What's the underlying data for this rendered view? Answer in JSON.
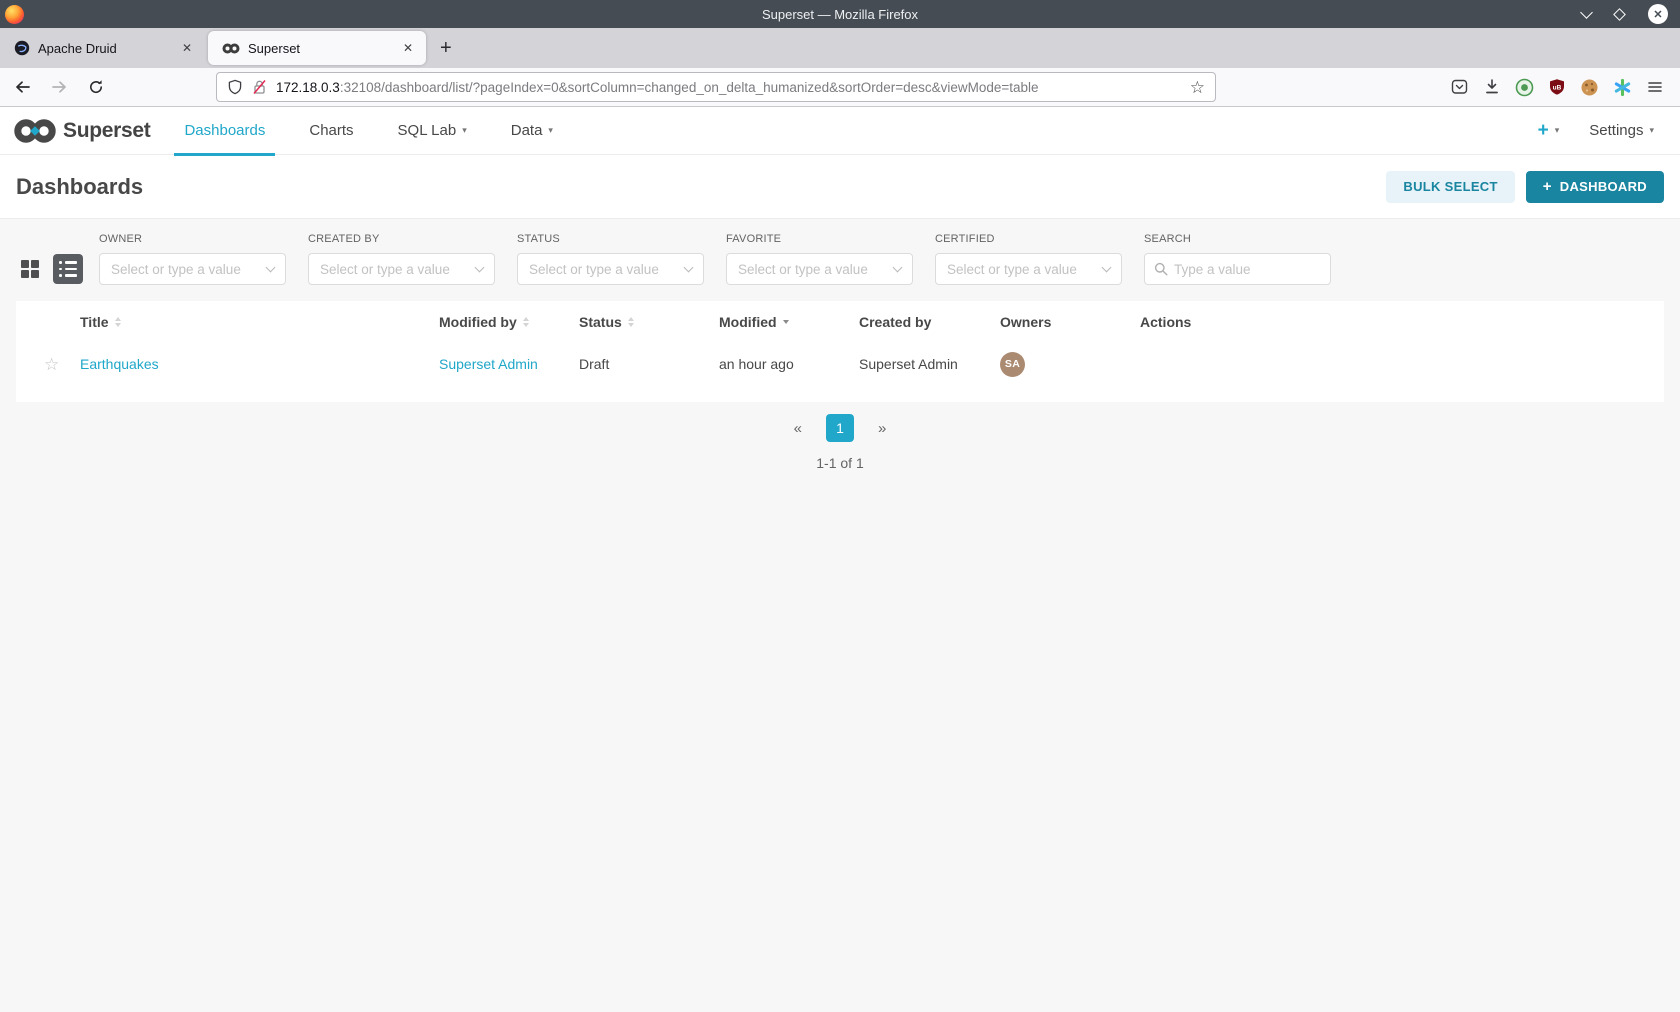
{
  "window": {
    "title": "Superset — Mozilla Firefox",
    "tabs": [
      {
        "label": "Apache Druid"
      },
      {
        "label": "Superset"
      }
    ],
    "urlbar": {
      "host": "172.18.0.3",
      "path": ":32108/dashboard/list/?pageIndex=0&sortColumn=changed_on_delta_humanized&sortOrder=desc&viewMode=table"
    }
  },
  "icons": {
    "close": "✕",
    "caret": "▾",
    "plus": "+",
    "star_outline": "☆",
    "new_tab": "+"
  },
  "navbar": {
    "brand": "Superset",
    "items": [
      {
        "label": "Dashboards"
      },
      {
        "label": "Charts"
      },
      {
        "label": "SQL Lab"
      },
      {
        "label": "Data"
      }
    ],
    "new_label": "+",
    "settings_label": "Settings"
  },
  "page": {
    "title": "Dashboards",
    "bulk_select": "BULK SELECT",
    "new_dashboard": "DASHBOARD"
  },
  "filters": [
    {
      "label": "OWNER",
      "placeholder": "Select or type a value"
    },
    {
      "label": "CREATED BY",
      "placeholder": "Select or type a value"
    },
    {
      "label": "STATUS",
      "placeholder": "Select or type a value"
    },
    {
      "label": "FAVORITE",
      "placeholder": "Select or type a value"
    },
    {
      "label": "CERTIFIED",
      "placeholder": "Select or type a value"
    }
  ],
  "search": {
    "label": "SEARCH",
    "placeholder": "Type a value"
  },
  "table": {
    "columns": [
      {
        "label": "Title"
      },
      {
        "label": "Modified by"
      },
      {
        "label": "Status"
      },
      {
        "label": "Modified"
      },
      {
        "label": "Created by"
      },
      {
        "label": "Owners"
      },
      {
        "label": "Actions"
      }
    ],
    "rows": [
      {
        "title": "Earthquakes",
        "modified_by": "Superset Admin",
        "status": "Draft",
        "modified": "an hour ago",
        "created_by": "Superset Admin",
        "owner_initials": "SA"
      }
    ]
  },
  "pagination": {
    "prev": "«",
    "current": "1",
    "next": "»",
    "summary": "1-1 of 1"
  },
  "colors": {
    "accent": "#20a7c9",
    "primary_button": "#1a85a0",
    "titlebar": "#454c54",
    "avatar": "#ab8a72"
  }
}
